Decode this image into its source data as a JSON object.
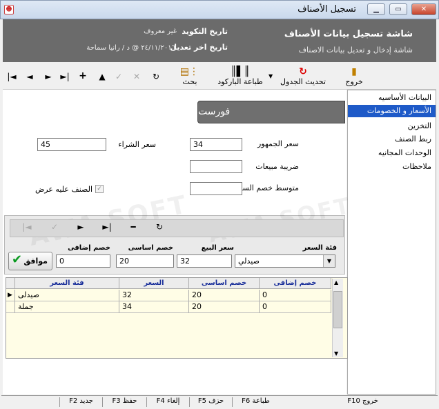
{
  "window": {
    "title": "تسجيل الأصناف",
    "controls": [
      "minimize",
      "maximize",
      "close"
    ]
  },
  "header": {
    "screen_title": "شاشة تسجيل بيانات الأصناف",
    "screen_subtitle": "شاشة إدخال و تعديل بيانات الاصناف",
    "coding_date_label": "تاريخ التكويد",
    "coding_date_value": "غير معروف",
    "modify_date_label": "تاريخ اخر تعديل",
    "modify_date_value": "٢٤/١١/٢٠١٦ @ د / رانيا سماحة"
  },
  "toolbar": {
    "exit": "خروج",
    "refresh": "تحديث الجدول",
    "barcode": "طباعة الباركود",
    "search": "بحث"
  },
  "sidebar": {
    "items": [
      {
        "label": "البيانات الأساسيه"
      },
      {
        "label": "الأسعار و الخصومات"
      },
      {
        "label": "التخزين"
      },
      {
        "label": "ربط الصنف"
      },
      {
        "label": "الوحدات المجانيه"
      },
      {
        "label": "ملاحظات"
      }
    ],
    "selected_index": 1
  },
  "item": {
    "name": "فورست"
  },
  "prices": {
    "public_price_label": "سعر الجمهور",
    "public_price": "34",
    "purchase_price_label": "سعر الشراء",
    "purchase_price": "45",
    "sales_tax_label": "ضريبة مبيعات",
    "sales_tax": "",
    "market_discount_label": "متوسط خصم السوق",
    "market_discount": "",
    "has_offer_label": "الصنف عليه عرض",
    "has_offer": true
  },
  "discounts": {
    "price_category_label": "فئة السعر",
    "price_category_value": "صيدلي",
    "sale_price_label": "سعر البيع",
    "sale_price": "32",
    "basic_discount_label": "خصم اساسى",
    "basic_discount": "20",
    "extra_discount_label": "خصم إضافى",
    "extra_discount": "0",
    "ok_label": "موافق"
  },
  "grid": {
    "columns": [
      "خصم إضافى",
      "خصم اساسى",
      "السعر",
      "فئة السعر"
    ],
    "rows": [
      {
        "category": "صيدلى",
        "price": "32",
        "basic": "20",
        "extra": "0"
      },
      {
        "category": "جملة",
        "price": "34",
        "basic": "20",
        "extra": "0"
      }
    ]
  },
  "statusbar": {
    "exit": "خروج F10",
    "print": "طباعة F6",
    "delete": "حزف F5",
    "cancel": "إلغاء F4",
    "save": "حفظ F3",
    "new": "جديد F2"
  },
  "watermark": "AWA SOFT"
}
